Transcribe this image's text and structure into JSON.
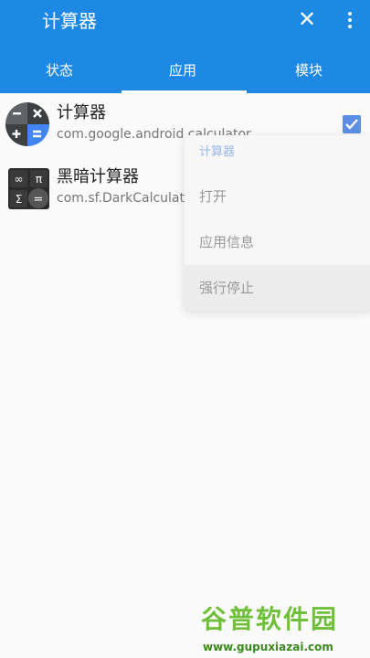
{
  "appbar": {
    "title": "计算器",
    "close_icon": "close-icon",
    "more_icon": "more-vert-icon",
    "color": "#1e88e5"
  },
  "tabs": [
    {
      "label": "状态"
    },
    {
      "label": "应用"
    },
    {
      "label": "模块"
    }
  ],
  "selected_tab": "应用",
  "apps": [
    {
      "name": "计算器",
      "package": "com.google.android.calculator",
      "checked": true,
      "icon": "google-calculator-icon"
    },
    {
      "name": "黑暗计算器",
      "package": "com.sf.DarkCalculator",
      "checked": false,
      "icon": "dark-calculator-icon"
    }
  ],
  "context_menu": {
    "header": "计算器",
    "items": [
      "打开",
      "应用信息",
      "强行停止"
    ],
    "highlighted": "强行停止"
  },
  "watermark": {
    "logo": "谷普软件园",
    "url": "www.gupuxiazai.com"
  }
}
